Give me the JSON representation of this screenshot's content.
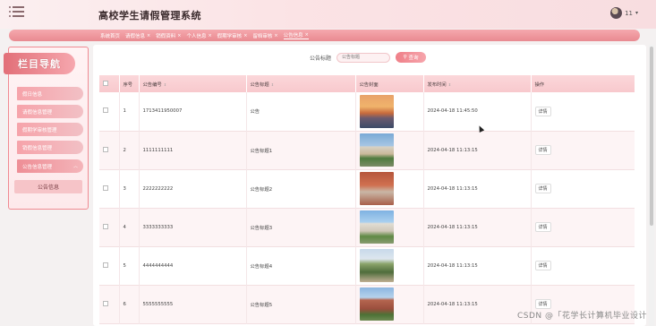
{
  "header": {
    "title": "高校学生请假管理系统",
    "username": "11",
    "caret": "▾"
  },
  "tabs": [
    {
      "label": "系统首页",
      "closable": false,
      "active": false
    },
    {
      "label": "请假信息",
      "closable": true,
      "active": false
    },
    {
      "label": "销假资料",
      "closable": true,
      "active": false
    },
    {
      "label": "个人信息",
      "closable": true,
      "active": false
    },
    {
      "label": "假期学审核",
      "closable": true,
      "active": false
    },
    {
      "label": "留档审核",
      "closable": true,
      "active": false
    },
    {
      "label": "公告信息",
      "closable": true,
      "active": true
    }
  ],
  "sidebar": {
    "logo_text": "栏目导航",
    "items": [
      {
        "label": "假日信息",
        "open": false
      },
      {
        "label": "请假信息管理",
        "open": false
      },
      {
        "label": "假期学审核管理",
        "open": false
      },
      {
        "label": "销假信息管理",
        "open": false
      },
      {
        "label": "公告信息管理",
        "open": true
      }
    ],
    "sub_item": "公告信息"
  },
  "search": {
    "label": "公告标题",
    "placeholder": "公告标题",
    "button_label": "查询",
    "button_icon": "search-icon"
  },
  "table": {
    "columns": [
      "序号",
      "公告编号",
      "公告标题",
      "公告封面",
      "发布时间",
      "操作"
    ],
    "action_label": "详情",
    "rows": [
      {
        "index": "1",
        "code": "1713411950007",
        "title": "公告",
        "image": "img-sunset",
        "time": "2024-04-18 11:45:50"
      },
      {
        "index": "2",
        "code": "1111111111",
        "title": "公告标题1",
        "image": "img-campus1",
        "time": "2024-04-18 11:13:15"
      },
      {
        "index": "3",
        "code": "2222222222",
        "title": "公告标题2",
        "image": "img-campus2",
        "time": "2024-04-18 11:13:15"
      },
      {
        "index": "4",
        "code": "3333333333",
        "title": "公告标题3",
        "image": "img-campus3",
        "time": "2024-04-18 11:13:15"
      },
      {
        "index": "5",
        "code": "4444444444",
        "title": "公告标题4",
        "image": "img-campus4",
        "time": "2024-04-18 11:13:15"
      },
      {
        "index": "6",
        "code": "5555555555",
        "title": "公告标题5",
        "image": "img-campus5",
        "time": "2024-04-18 11:13:15"
      }
    ]
  },
  "watermark": "CSDN @「花学长计算机毕业设计"
}
